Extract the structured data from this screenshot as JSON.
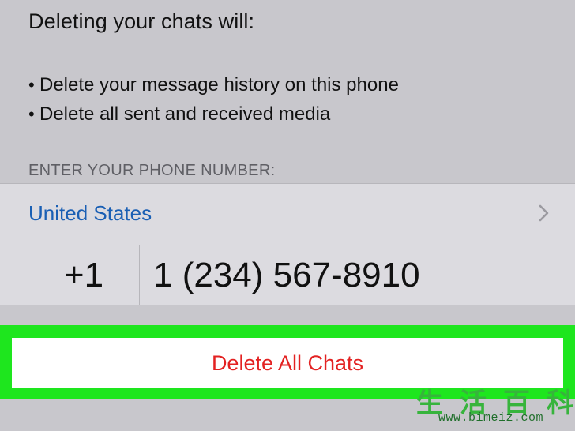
{
  "info": {
    "heading": "Deleting your chats will:",
    "bullet_glyph": "•",
    "bullets": [
      "Delete your message history on this phone",
      "Delete all sent and received media"
    ]
  },
  "phone_section": {
    "label": "ENTER YOUR PHONE NUMBER:",
    "country": "United States",
    "country_code": "+1",
    "phone_number": "1 (234) 567-8910"
  },
  "action": {
    "delete_label": "Delete All Chats",
    "highlight_color": "#1ee61e",
    "label_color": "#e32222"
  },
  "watermark": {
    "chars": [
      "生",
      "活",
      "百",
      "科"
    ],
    "url": "www.bimeiz.com"
  },
  "icons": {
    "disclosure": "chevron-right-icon"
  }
}
